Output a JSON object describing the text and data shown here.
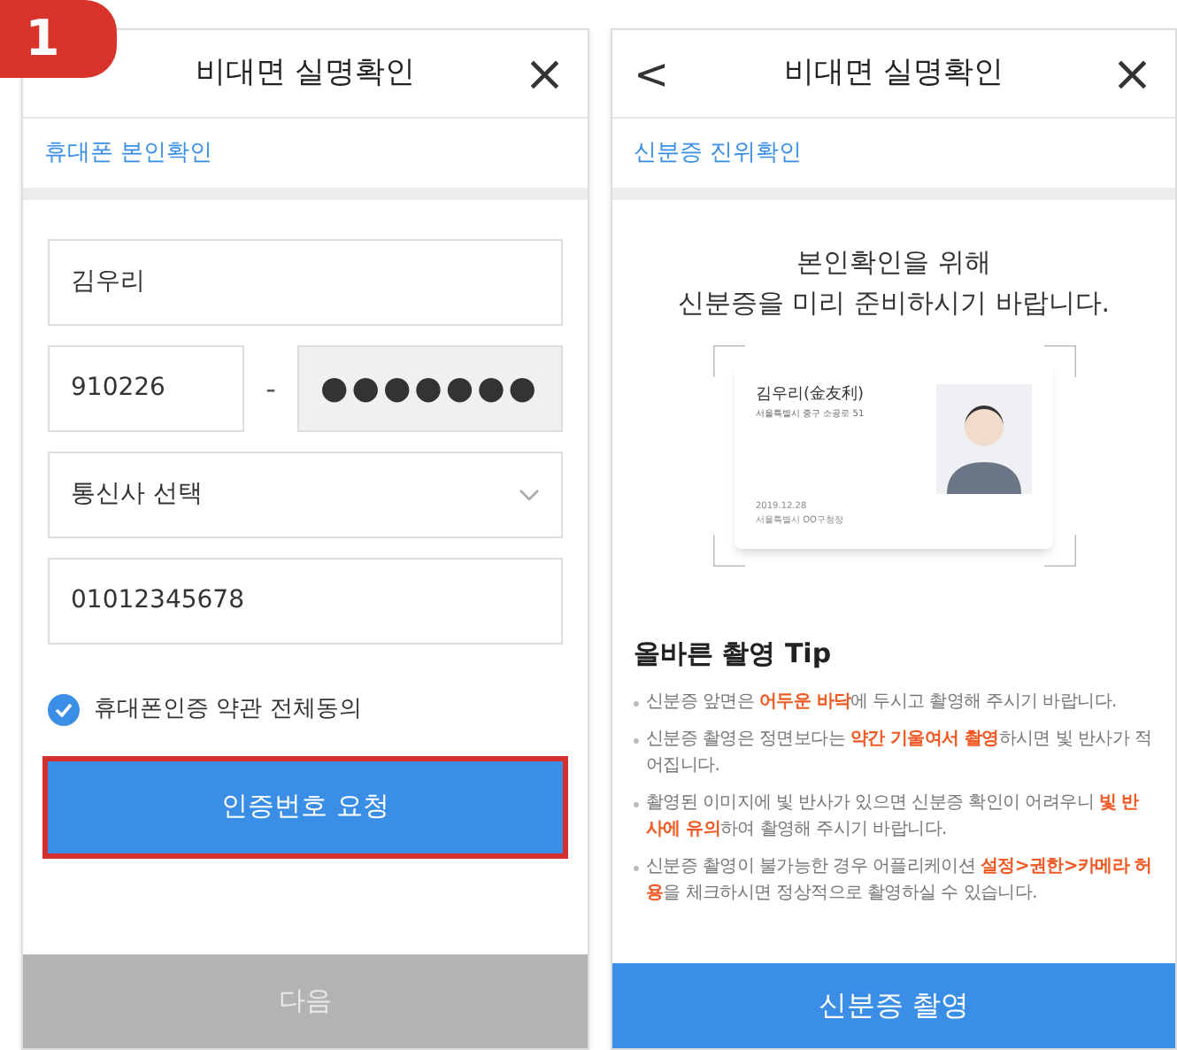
{
  "step_badge": "1",
  "left_screen": {
    "title": "비대면 실명확인",
    "close": "×",
    "section": "휴대폰 본인확인",
    "name_field": {
      "value": "김우리"
    },
    "birth_field": {
      "value": "910226"
    },
    "separator": "-",
    "id_back_field": {
      "value": "●●●●●●●"
    },
    "carrier_select": {
      "value": "통신사 선택"
    },
    "phone_field": {
      "value": "01012345678"
    },
    "agree": {
      "label": "휴대폰인증 약관 전체동의",
      "checked": true
    },
    "request_button": {
      "label": "인증번호 요청",
      "highlighted": true
    },
    "next_button": {
      "label": "다음",
      "disabled": true
    }
  },
  "right_screen": {
    "back": "<",
    "title": "비대면 실명확인",
    "close": "×",
    "section": "신분증 진위확인",
    "intro": [
      "본인확인을 위해",
      "신분증을 미리 준비하시기 바랍니다."
    ],
    "id_card": {
      "name": "김우리(金友利)",
      "address": "서울특별시 중구 소공로 51",
      "date": "2019.12.28",
      "issuer": "서울특별시 OO구청장"
    },
    "tips_title": "올바른 촬영 Tip",
    "tips": [
      "신분증 앞면은 **어두운 바닥**에 두시고 촬영해 주시기 바랍니다.",
      "신분증 촬영은 정면보다는 **약간 기울여서 촬영**하시면 빛 반사가 적어집니다.",
      "촬영된 이미지에 빛 반사가 있으면 신분증 확인이 어려우니 **빛 반사에 유의**하여 촬영해 주시기 바랍니다.",
      "신분증 촬영이 불가능한 경우 어플리케이션 **설정>권한>카메라 허용**을 체크하시면 정상적으로 촬영하실 수 있습니다."
    ],
    "capture_button": {
      "label": "신분증 촬영"
    }
  }
}
